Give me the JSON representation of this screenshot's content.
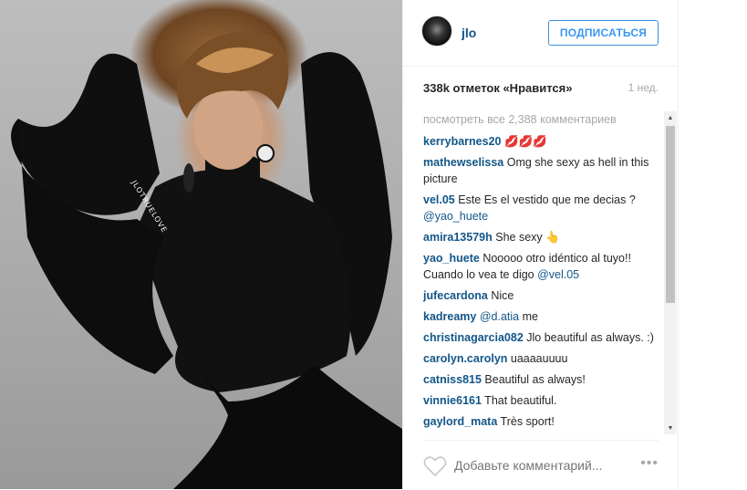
{
  "photo": {
    "watermark": "JLOTRUELOVE"
  },
  "header": {
    "username": "jlo",
    "follow_label": "ПОДПИСАТЬСЯ"
  },
  "stats": {
    "likes": "338k отметок «Нравится»",
    "time": "1 нед."
  },
  "comments": {
    "view_all": "посмотреть все 2,388 комментариев",
    "items": [
      {
        "user": "kerrybarnes20",
        "text": " 💋💋💋"
      },
      {
        "user": "mathewselissa",
        "text": " Omg she sexy as hell in this picture"
      },
      {
        "user": "vel.05",
        "text": " Este Es el vestido que me decias ? ",
        "mention": "@yao_huete"
      },
      {
        "user": "amira13579h",
        "text": " She sexy 👆"
      },
      {
        "user": "yao_huete",
        "text": " Nooooo otro idéntico al tuyo!! Cuando lo vea te digo ",
        "mention": "@vel.05"
      },
      {
        "user": "jufecardona",
        "text": " Nice"
      },
      {
        "user": "kadreamy",
        "text": " ",
        "mention": "@d.atia",
        "after": " me"
      },
      {
        "user": "christinagarcia082",
        "text": " Jlo beautiful as always. :)"
      },
      {
        "user": "carolyn.carolyn",
        "text": " uaaaauuuu"
      },
      {
        "user": "catniss815",
        "text": " Beautiful as always!"
      },
      {
        "user": "vinnie6161",
        "text": " That beautiful."
      },
      {
        "user": "gaylord_mata",
        "text": " Très sport!"
      }
    ]
  },
  "footer": {
    "placeholder": "Добавьте комментарий...",
    "more": "•••"
  },
  "icons": {
    "heart": "heart-icon",
    "more": "more-options-icon"
  }
}
